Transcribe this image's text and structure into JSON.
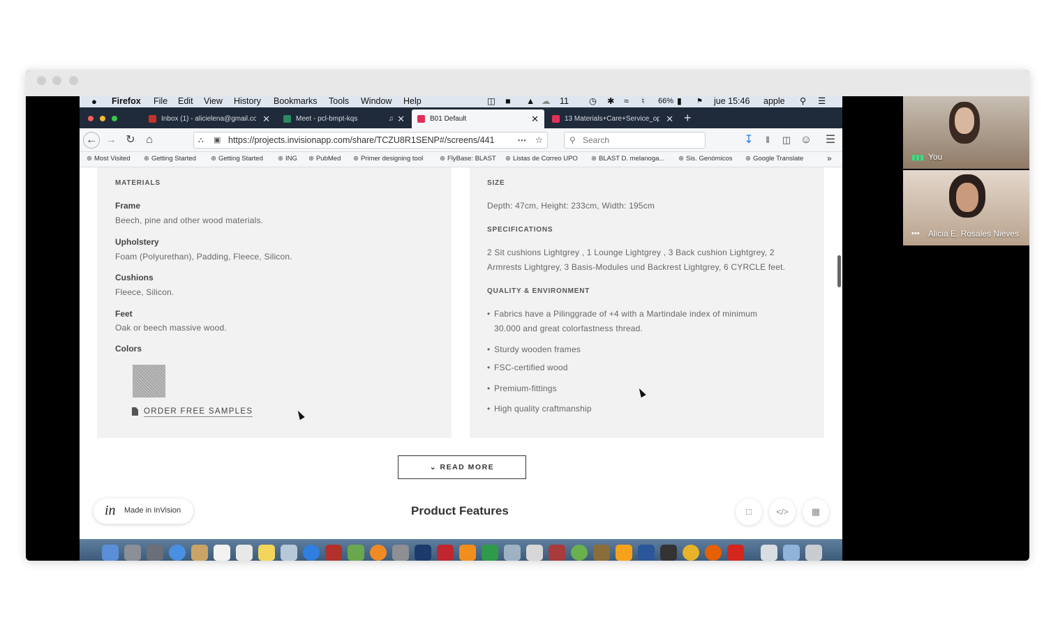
{
  "mac_menu": {
    "app": "Firefox",
    "items": [
      "File",
      "Edit",
      "View",
      "History",
      "Bookmarks",
      "Tools",
      "Window",
      "Help"
    ],
    "status": {
      "badge_count": "11",
      "battery": "66%",
      "datetime": "jue 15:46",
      "user": "apple"
    }
  },
  "tabs": [
    {
      "label": "Inbox (1) - alicielena@gmail.co",
      "favicon_color": "#c5332a"
    },
    {
      "label": "Meet - pcl-bmpt-kqs",
      "favicon_color": "#2b8a5f"
    },
    {
      "label": "B01 Default",
      "favicon_color": "#e0315b"
    },
    {
      "label": "13 Materials+Care+Service_op",
      "favicon_color": "#e0315b"
    }
  ],
  "nav": {
    "url": "https://projects.invisionapp.com/share/TCZU8R1SENP#/screens/441",
    "search_placeholder": "Search"
  },
  "bookmarks": [
    "Most Visited",
    "Getting Started",
    "Getting Started",
    "ING",
    "PubMed",
    "Primer designing tool",
    "FlyBase: BLAST",
    "Listas de Correo UPO",
    "BLAST D. melanoga...",
    "Sis. Genómicos",
    "Google Translate"
  ],
  "materials": {
    "heading": "MATERIALS",
    "items": [
      {
        "label": "Frame",
        "text": "Beech, pine and other wood materials."
      },
      {
        "label": "Upholstery",
        "text": "Foam (Polyurethan), Padding, Fleece, Silicon."
      },
      {
        "label": "Cushions",
        "text": "Fleece, Silicon."
      },
      {
        "label": "Feet",
        "text": "Oak or beech massive wood."
      }
    ],
    "colors_label": "Colors",
    "order_link": "ORDER FREE SAMPLES"
  },
  "specs": {
    "size_heading": "SIZE",
    "size_text": "Depth: 47cm, Height: 233cm, Width: 195cm",
    "spec_heading": "SPECIFICATIONS",
    "spec_line1": "2 Sit cushions Lightgrey , 1 Lounge Lightgrey , 3 Back cushion Lightgrey, 2",
    "spec_line2": "Armrests Lightgrey, 3 Basis-Modules und Backrest Lightgrey, 6 CYRCLE feet.",
    "quality_heading": "QUALITY & ENVIRONMENT",
    "quality_items": [
      "Fabrics have a Pilinggrade of +4 with a Martindale index of minimum",
      "30.000 and great colorfastness thread.",
      "Sturdy wooden frames",
      "FSC-certified wood",
      "Premium-fittings",
      "High quality craftmanship"
    ]
  },
  "read_more": "READ MORE",
  "invision_badge": {
    "logo": "in",
    "text": "Made in InVision"
  },
  "product_features": "Product Features",
  "participants": [
    {
      "name": "You"
    },
    {
      "name": "Alicia E. Rosales Nieves"
    }
  ],
  "colors": {
    "accent": "#e0315b",
    "tab_strip": "#1f2a3a",
    "menu_bar": "#dfe6ef"
  }
}
